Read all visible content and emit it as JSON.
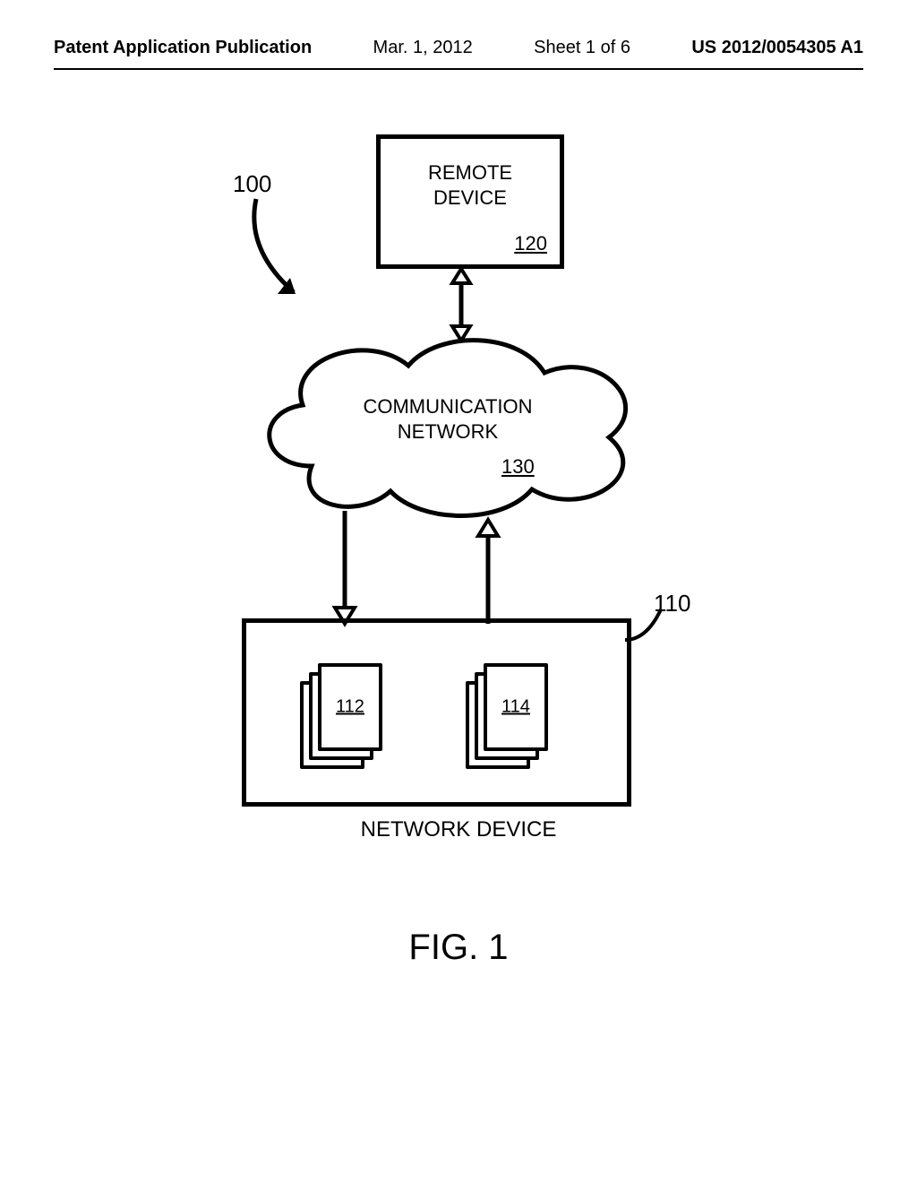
{
  "header": {
    "publication": "Patent Application Publication",
    "date": "Mar. 1, 2012",
    "sheet": "Sheet 1 of 6",
    "docnum": "US 2012/0054305 A1"
  },
  "diagram": {
    "system_ref": "100",
    "remote_device": {
      "title_l1": "REMOTE",
      "title_l2": "DEVICE",
      "ref": "120"
    },
    "cloud": {
      "title_l1": "COMMUNICATION",
      "title_l2": "NETWORK",
      "ref": "130"
    },
    "network_device": {
      "ref": "110",
      "caption": "NETWORK DEVICE",
      "stack_left_ref": "112",
      "stack_right_ref": "114"
    }
  },
  "figure_caption": "FIG. 1"
}
